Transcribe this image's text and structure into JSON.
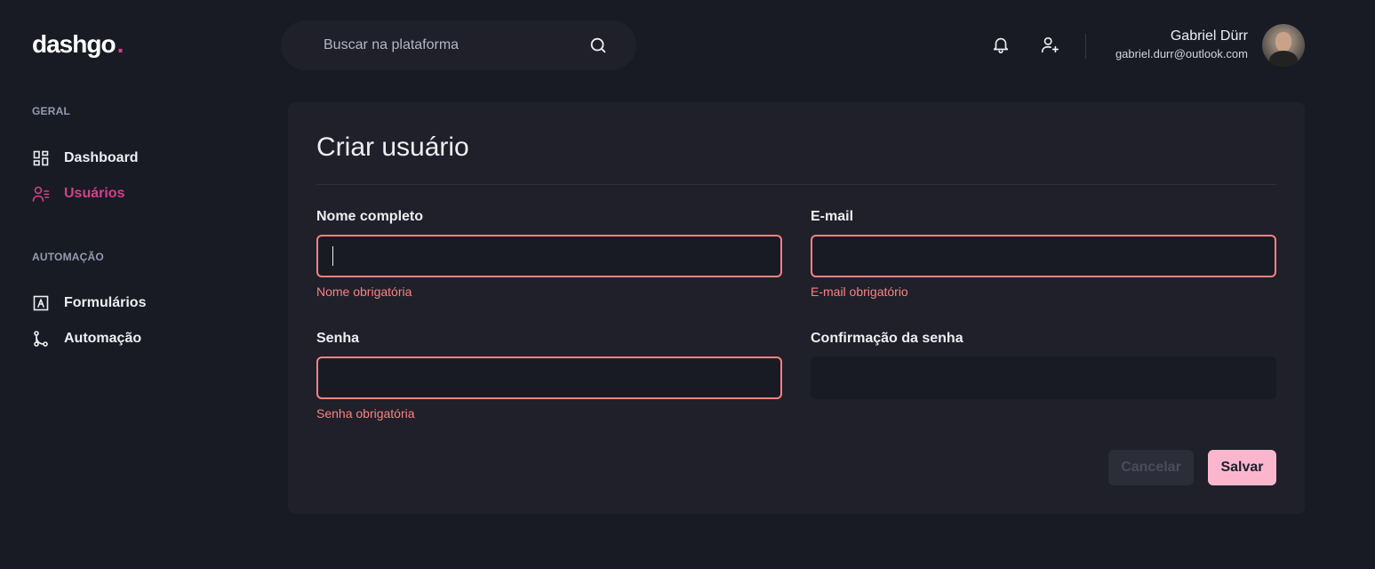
{
  "brand": {
    "name": "dashgo",
    "dot": "."
  },
  "search": {
    "placeholder": "Buscar na plataforma"
  },
  "user": {
    "name": "Gabriel Dürr",
    "email": "gabriel.durr@outlook.com"
  },
  "sidebar": {
    "sections": [
      {
        "title": "GERAL",
        "items": [
          {
            "label": "Dashboard",
            "icon": "dashboard-icon"
          },
          {
            "label": "Usuários",
            "icon": "users-icon",
            "active": true
          }
        ]
      },
      {
        "title": "AUTOMAÇÃO",
        "items": [
          {
            "label": "Formulários",
            "icon": "form-icon"
          },
          {
            "label": "Automação",
            "icon": "git-merge-icon"
          }
        ]
      }
    ]
  },
  "form": {
    "title": "Criar usuário",
    "fields": {
      "name": {
        "label": "Nome completo",
        "value": "",
        "error": "Nome obrigatória"
      },
      "email": {
        "label": "E-mail",
        "value": "",
        "error": "E-mail obrigatório"
      },
      "password": {
        "label": "Senha",
        "value": "",
        "error": "Senha obrigatória"
      },
      "password_confirmation": {
        "label": "Confirmação da senha",
        "value": ""
      }
    },
    "buttons": {
      "cancel": "Cancelar",
      "save": "Salvar"
    }
  },
  "colors": {
    "background": "#181b23",
    "surface": "#1f2029",
    "accent": "#d53f8c",
    "error": "#fc8181",
    "save_button": "#fbb6ce"
  }
}
